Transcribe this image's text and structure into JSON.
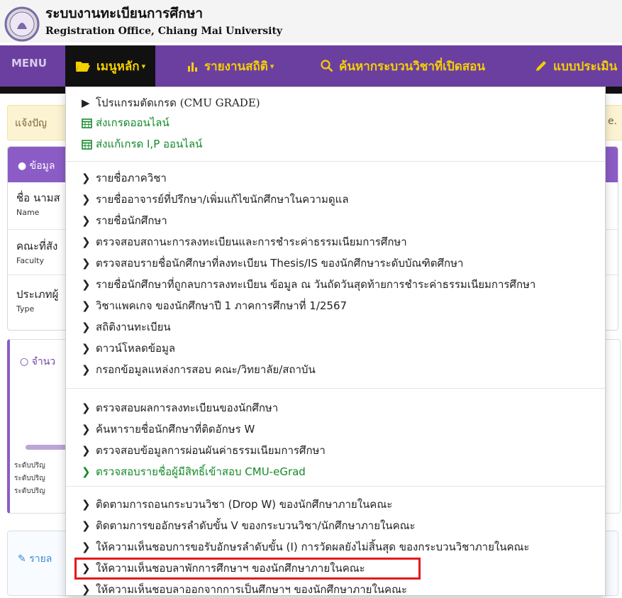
{
  "header": {
    "title_th": "ระบบงานทะเบียนการศึกษา",
    "title_en": "Registration Office, Chiang Mai University"
  },
  "navbar": {
    "menu_label": "MENU",
    "items": [
      {
        "label": "เมนูหลัก",
        "icon": "folder-open-icon",
        "active": true
      },
      {
        "label": "รายงานสถิติ",
        "icon": "bar-chart-icon"
      },
      {
        "label": "ค้นหากระบวนวิชาที่เปิดสอน",
        "icon": "search-icon"
      },
      {
        "label": "แบบประเมิน",
        "icon": "pencil-icon"
      }
    ]
  },
  "alert": {
    "text_start": "แจ้งปัญ",
    "text_end": "e."
  },
  "panel_info": {
    "heading": "ข้อมูล",
    "rows": [
      {
        "label": "ชื่อ นามส",
        "sub": "Name"
      },
      {
        "label": "คณะที่สัง",
        "sub": "Faculty"
      },
      {
        "label": "ประเภทผู้",
        "sub": "Type"
      }
    ]
  },
  "panel_count": {
    "heading": "จำนว",
    "levels": [
      "ระดับปริญ",
      "ระดับปริญ",
      "ระดับปริญ"
    ]
  },
  "panel_report": {
    "heading": "รายล"
  },
  "dropdown": {
    "group1": [
      {
        "label": "โปรแกรมตัดเกรด (CMU GRADE)",
        "icon": "triangle-right-icon",
        "style": "dark"
      },
      {
        "label": "ส่งเกรดออนไลน์",
        "icon": "calendar-icon",
        "style": "green"
      },
      {
        "label": "ส่งแก้เกรด I,P ออนไลน์",
        "icon": "calendar-icon",
        "style": "green"
      }
    ],
    "group2": [
      "รายชื่อภาควิชา",
      "รายชื่ออาจารย์ที่ปรึกษา/เพิ่มแก้ไขนักศึกษาในความดูแล",
      "รายชื่อนักศึกษา",
      "ตรวจสอบสถานะการลงทะเบียนและการชำระค่าธรรมเนียมการศึกษา",
      "ตรวจสอบรายชื่อนักศึกษาที่ลงทะเบียน Thesis/IS ของนักศึกษาระดับบัณฑิตศึกษา",
      "รายชื่อนักศึกษาที่ถูกลบการลงทะเบียน ข้อมูล ณ วันถัดวันสุดท้ายการชำระค่าธรรมเนียมการศึกษา",
      "วิชาแพคเกจ ของนักศึกษาปี 1 ภาคการศึกษาที่ 1/2567",
      "สถิติงานทะเบียน",
      "ดาวน์โหลดข้อมูล",
      "กรอกข้อมูลแหล่งการสอบ คณะ/วิทยาลัย/สถาบัน"
    ],
    "group3": [
      {
        "label": "ตรวจสอบผลการลงทะเบียนของนักศึกษา",
        "style": "dark"
      },
      {
        "label": "ค้นหารายชื่อนักศึกษาที่ติดอักษร W",
        "style": "dark"
      },
      {
        "label": "ตรวจสอบข้อมูลการผ่อนผันค่าธรรมเนียมการศึกษา",
        "style": "dark"
      },
      {
        "label": "ตรวจสอบรายชื่อผู้มีสิทธิ์เข้าสอบ CMU-eGrad",
        "style": "green"
      }
    ],
    "group4": [
      "ติดตามการถอนกระบวนวิชา (Drop W) ของนักศึกษาภายในคณะ",
      "ติดตามการขออักษรลำดับขั้น V ของกระบวนวิชา/นักศึกษาภายในคณะ",
      "ให้ความเห็นชอบการขอรับอักษรลำดับขั้น (I) การวัดผลยังไม่สิ้นสุด ของกระบวนวิชาภายในคณะ",
      "ให้ความเห็นชอบลาพักการศึกษาฯ ของนักศึกษาภายในคณะ",
      "ให้ความเห็นชอบลาออกจากการเป็นศึกษาฯ ของนักศึกษาภายในคณะ"
    ],
    "highlighted_index": 3
  },
  "colors": {
    "nav_bg": "#6b3fa0",
    "nav_text": "#f5d000",
    "green": "#158a2a",
    "highlight": "#e21b1b"
  }
}
